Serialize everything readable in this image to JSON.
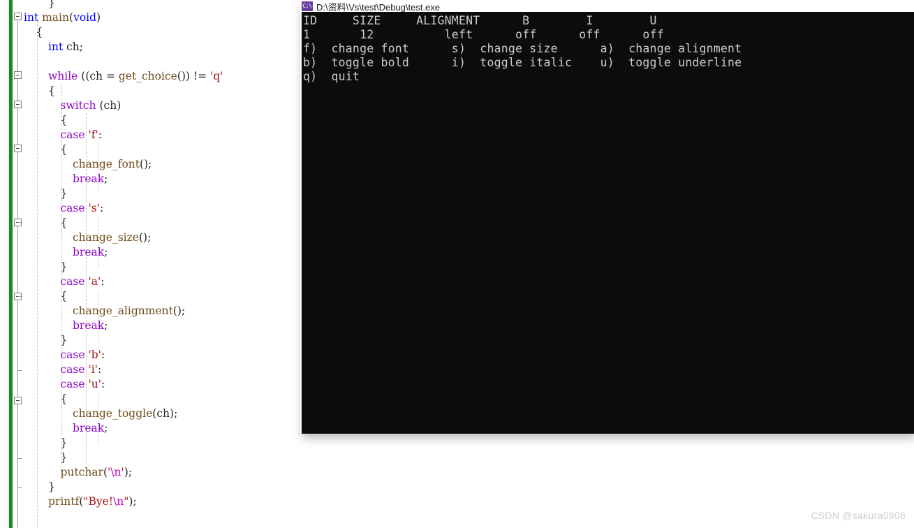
{
  "editor": {
    "name": "code-editor",
    "language": "C",
    "change_bar_color": "#1d891d",
    "background": "#ffffff",
    "code_lines": [
      {
        "indent": 2,
        "tokens": [
          {
            "t": "}",
            "c": "punc"
          }
        ]
      },
      {
        "indent": 0,
        "tokens": [
          {
            "t": "int",
            "c": "kw"
          },
          {
            "t": " ",
            "c": "plain"
          },
          {
            "t": "main",
            "c": "fn"
          },
          {
            "t": "(",
            "c": "punc"
          },
          {
            "t": "void",
            "c": "kw"
          },
          {
            "t": ")",
            "c": "punc"
          }
        ]
      },
      {
        "indent": 1,
        "tokens": [
          {
            "t": "{",
            "c": "punc"
          }
        ]
      },
      {
        "indent": 2,
        "tokens": [
          {
            "t": "int",
            "c": "kw"
          },
          {
            "t": " ch;",
            "c": "plain"
          }
        ]
      },
      {
        "indent": 0,
        "tokens": []
      },
      {
        "indent": 2,
        "tokens": [
          {
            "t": "while",
            "c": "kw2"
          },
          {
            "t": " ((ch = ",
            "c": "plain"
          },
          {
            "t": "get_choice",
            "c": "fn"
          },
          {
            "t": "()) != ",
            "c": "plain"
          },
          {
            "t": "'q'",
            "c": "str"
          }
        ]
      },
      {
        "indent": 2,
        "tokens": [
          {
            "t": "{",
            "c": "punc"
          }
        ]
      },
      {
        "indent": 3,
        "tokens": [
          {
            "t": "switch",
            "c": "kw2"
          },
          {
            "t": " (ch)",
            "c": "plain"
          }
        ]
      },
      {
        "indent": 3,
        "tokens": [
          {
            "t": "{",
            "c": "punc"
          }
        ]
      },
      {
        "indent": 3,
        "tokens": [
          {
            "t": "case",
            "c": "kw2"
          },
          {
            "t": " ",
            "c": "plain"
          },
          {
            "t": "'f'",
            "c": "str"
          },
          {
            "t": ":",
            "c": "plain"
          }
        ]
      },
      {
        "indent": 3,
        "tokens": [
          {
            "t": "{",
            "c": "punc"
          }
        ]
      },
      {
        "indent": 4,
        "tokens": [
          {
            "t": "change_font",
            "c": "fn"
          },
          {
            "t": "();",
            "c": "plain"
          }
        ]
      },
      {
        "indent": 4,
        "tokens": [
          {
            "t": "break",
            "c": "kw2"
          },
          {
            "t": ";",
            "c": "plain"
          }
        ]
      },
      {
        "indent": 3,
        "tokens": [
          {
            "t": "}",
            "c": "punc"
          }
        ]
      },
      {
        "indent": 3,
        "tokens": [
          {
            "t": "case",
            "c": "kw2"
          },
          {
            "t": " ",
            "c": "plain"
          },
          {
            "t": "'s'",
            "c": "str"
          },
          {
            "t": ":",
            "c": "plain"
          }
        ]
      },
      {
        "indent": 3,
        "tokens": [
          {
            "t": "{",
            "c": "punc"
          }
        ]
      },
      {
        "indent": 4,
        "tokens": [
          {
            "t": "change_size",
            "c": "fn"
          },
          {
            "t": "();",
            "c": "plain"
          }
        ]
      },
      {
        "indent": 4,
        "tokens": [
          {
            "t": "break",
            "c": "kw2"
          },
          {
            "t": ";",
            "c": "plain"
          }
        ]
      },
      {
        "indent": 3,
        "tokens": [
          {
            "t": "}",
            "c": "punc"
          }
        ]
      },
      {
        "indent": 3,
        "tokens": [
          {
            "t": "case",
            "c": "kw2"
          },
          {
            "t": " ",
            "c": "plain"
          },
          {
            "t": "'a'",
            "c": "str"
          },
          {
            "t": ":",
            "c": "plain"
          }
        ]
      },
      {
        "indent": 3,
        "tokens": [
          {
            "t": "{",
            "c": "punc"
          }
        ]
      },
      {
        "indent": 4,
        "tokens": [
          {
            "t": "change_alignment",
            "c": "fn"
          },
          {
            "t": "();",
            "c": "plain"
          }
        ]
      },
      {
        "indent": 4,
        "tokens": [
          {
            "t": "break",
            "c": "kw2"
          },
          {
            "t": ";",
            "c": "plain"
          }
        ]
      },
      {
        "indent": 3,
        "tokens": [
          {
            "t": "}",
            "c": "punc"
          }
        ]
      },
      {
        "indent": 3,
        "tokens": [
          {
            "t": "case",
            "c": "kw2"
          },
          {
            "t": " ",
            "c": "plain"
          },
          {
            "t": "'b'",
            "c": "str"
          },
          {
            "t": ":",
            "c": "plain"
          }
        ]
      },
      {
        "indent": 3,
        "tokens": [
          {
            "t": "case",
            "c": "kw2"
          },
          {
            "t": " ",
            "c": "plain"
          },
          {
            "t": "'i'",
            "c": "str"
          },
          {
            "t": ":",
            "c": "plain"
          }
        ]
      },
      {
        "indent": 3,
        "tokens": [
          {
            "t": "case",
            "c": "kw2"
          },
          {
            "t": " ",
            "c": "plain"
          },
          {
            "t": "'u'",
            "c": "str"
          },
          {
            "t": ":",
            "c": "plain"
          }
        ]
      },
      {
        "indent": 3,
        "tokens": [
          {
            "t": "{",
            "c": "punc"
          }
        ]
      },
      {
        "indent": 4,
        "tokens": [
          {
            "t": "change_toggle",
            "c": "fn"
          },
          {
            "t": "(",
            "c": "punc"
          },
          {
            "t": "ch",
            "c": "var"
          },
          {
            "t": ");",
            "c": "plain"
          }
        ]
      },
      {
        "indent": 4,
        "tokens": [
          {
            "t": "break",
            "c": "kw2"
          },
          {
            "t": ";",
            "c": "plain"
          }
        ]
      },
      {
        "indent": 3,
        "tokens": [
          {
            "t": "}",
            "c": "punc"
          }
        ]
      },
      {
        "indent": 3,
        "tokens": [
          {
            "t": "}",
            "c": "punc"
          }
        ]
      },
      {
        "indent": 3,
        "tokens": [
          {
            "t": "putchar",
            "c": "fn"
          },
          {
            "t": "(",
            "c": "punc"
          },
          {
            "t": "'",
            "c": "str"
          },
          {
            "t": "\\n",
            "c": "esc"
          },
          {
            "t": "'",
            "c": "str"
          },
          {
            "t": ");",
            "c": "plain"
          }
        ]
      },
      {
        "indent": 2,
        "tokens": [
          {
            "t": "}",
            "c": "punc"
          }
        ]
      },
      {
        "indent": 2,
        "tokens": [
          {
            "t": "printf",
            "c": "fn"
          },
          {
            "t": "(",
            "c": "punc"
          },
          {
            "t": "\"Bye!",
            "c": "str"
          },
          {
            "t": "\\n",
            "c": "esc"
          },
          {
            "t": "\"",
            "c": "str"
          },
          {
            "t": ");",
            "c": "plain"
          }
        ]
      }
    ],
    "fold_markers": [
      18,
      102,
      144,
      207,
      313,
      419,
      568
    ],
    "outline_ticks": [
      318,
      424,
      530,
      656,
      698
    ]
  },
  "console": {
    "name": "console-window",
    "title": "D:\\资料\\Vs\\test\\Debug\\test.exe",
    "icon": "console-icon",
    "icon_glyph": "C:\\",
    "background": "#0c0c0c",
    "foreground": "#cccccc",
    "lines": [
      "ID     SIZE     ALIGNMENT      B        I        U",
      "1       12          left      off      off      off",
      "f)  change font      s)  change size      a)  change alignment",
      "b)  toggle bold      i)  toggle italic    u)  toggle underline",
      "q)  quit"
    ],
    "table": {
      "headers": [
        "ID",
        "SIZE",
        "ALIGNMENT",
        "B",
        "I",
        "U"
      ],
      "rows": [
        [
          "1",
          "12",
          "left",
          "off",
          "off",
          "off"
        ]
      ]
    },
    "menu": [
      {
        "key": "f",
        "label": "change font"
      },
      {
        "key": "s",
        "label": "change size"
      },
      {
        "key": "a",
        "label": "change alignment"
      },
      {
        "key": "b",
        "label": "toggle bold"
      },
      {
        "key": "i",
        "label": "toggle italic"
      },
      {
        "key": "u",
        "label": "toggle underline"
      },
      {
        "key": "q",
        "label": "quit"
      }
    ]
  },
  "watermark": {
    "text": "CSDN @sakura0908"
  }
}
